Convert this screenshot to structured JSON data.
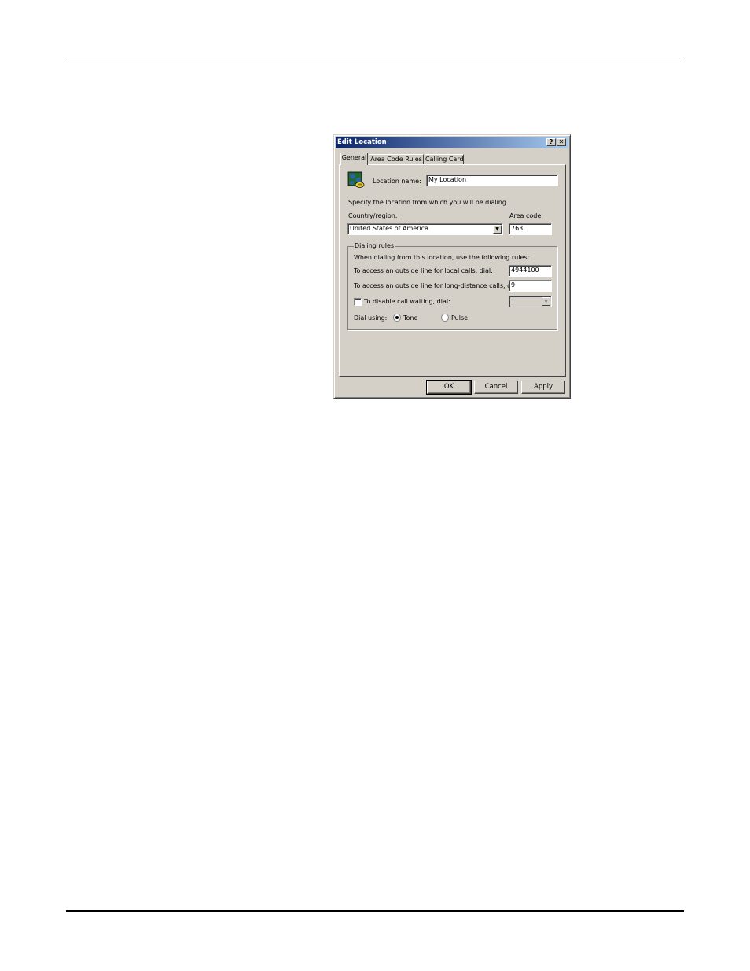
{
  "dialog": {
    "title": "Edit Location",
    "help_glyph": "?",
    "close_glyph": "✕"
  },
  "tabs": [
    {
      "label": "General",
      "active": true
    },
    {
      "label": "Area Code Rules",
      "active": false
    },
    {
      "label": "Calling Card",
      "active": false
    }
  ],
  "general": {
    "location_icon": "globe-phone-icon",
    "location_name_label": "Location name:",
    "location_name_value": "My Location",
    "instruction": "Specify the location from which you will be dialing.",
    "country_label": "Country/region:",
    "country_value": "United States of America",
    "area_code_label": "Area code:",
    "area_code_value": "763",
    "dropdown_glyph": "▼"
  },
  "dialing_rules": {
    "group_title": "Dialing rules",
    "intro": "When dialing from this location, use the following rules:",
    "local_label": "To access an outside line for local calls, dial:",
    "local_value": "4944100",
    "long_distance_label": "To access an outside line for long-distance calls, dial:",
    "long_distance_value": "9",
    "call_waiting_label": "To disable call waiting, dial:",
    "call_waiting_checked": false,
    "dial_using_label": "Dial using:",
    "tone_label": "Tone",
    "pulse_label": "Pulse",
    "selected": "Tone"
  },
  "buttons": {
    "ok": "OK",
    "cancel": "Cancel",
    "apply": "Apply"
  }
}
